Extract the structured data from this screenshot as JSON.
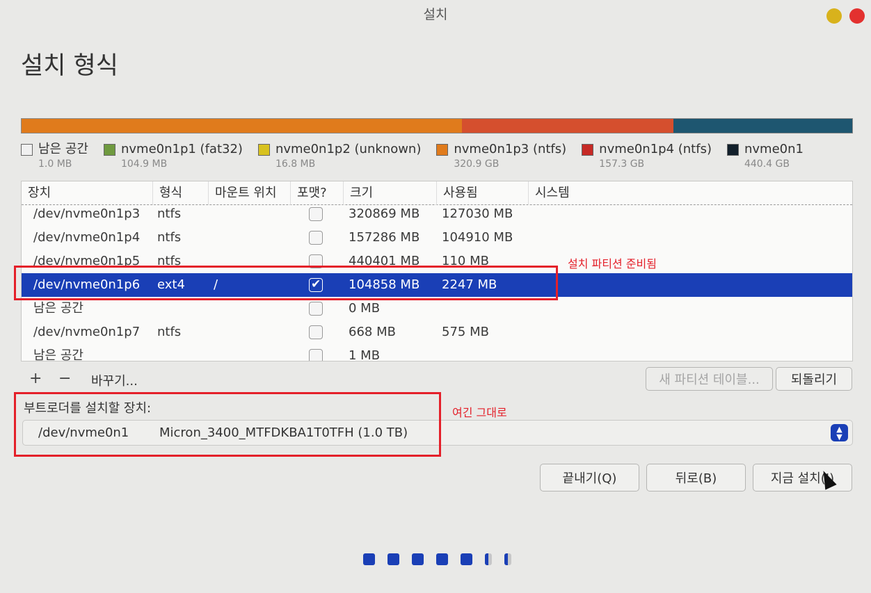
{
  "window": {
    "title": "설치"
  },
  "page": {
    "title": "설치 형식"
  },
  "disk_bar": [
    {
      "name": "nvme0n1p3",
      "color": "#e07b1c",
      "fraction": 0.53
    },
    {
      "name": "nvme0n1p4",
      "color": "#d54f2e",
      "fraction": 0.255
    },
    {
      "name": "nvme0n1p5",
      "color": "#1e5670",
      "fraction": 0.215
    }
  ],
  "legend": [
    {
      "name": "남은 공간",
      "size": "1.0 MB",
      "color": "#f0f0f0"
    },
    {
      "name": "nvme0n1p1 (fat32)",
      "size": "104.9 MB",
      "color": "#6f9a3f"
    },
    {
      "name": "nvme0n1p2 (unknown)",
      "size": "16.8 MB",
      "color": "#d8c21f"
    },
    {
      "name": "nvme0n1p3 (ntfs)",
      "size": "320.9 GB",
      "color": "#e07b1c"
    },
    {
      "name": "nvme0n1p4 (ntfs)",
      "size": "157.3 GB",
      "color": "#c62a25"
    },
    {
      "name": "nvme0n1",
      "size": "440.4 GB",
      "color": "#12202b"
    }
  ],
  "table": {
    "columns": [
      "장치",
      "형식",
      "마운트 위치",
      "포맷?",
      "크기",
      "사용됨",
      "시스템"
    ],
    "rows": [
      {
        "device": "/dev/nvme0n1p3",
        "type": "ntfs",
        "mount": "",
        "format": false,
        "size": "320869 MB",
        "used": "127030 MB",
        "selected": false,
        "checkbox": true
      },
      {
        "device": "/dev/nvme0n1p4",
        "type": "ntfs",
        "mount": "",
        "format": false,
        "size": "157286 MB",
        "used": "104910 MB",
        "selected": false,
        "checkbox": true
      },
      {
        "device": "/dev/nvme0n1p5",
        "type": "ntfs",
        "mount": "",
        "format": false,
        "size": "440401 MB",
        "used": "110 MB",
        "selected": false,
        "checkbox": true
      },
      {
        "device": "/dev/nvme0n1p6",
        "type": "ext4",
        "mount": "/",
        "format": true,
        "size": "104858 MB",
        "used": "2247 MB",
        "selected": true,
        "checkbox": true
      },
      {
        "device": "남은 공간",
        "type": "",
        "mount": "",
        "format": false,
        "size": "0 MB",
        "used": "",
        "selected": false,
        "checkbox": true
      },
      {
        "device": "/dev/nvme0n1p7",
        "type": "ntfs",
        "mount": "",
        "format": false,
        "size": "668 MB",
        "used": "575 MB",
        "selected": false,
        "checkbox": true
      },
      {
        "device": "남은 공간",
        "type": "",
        "mount": "",
        "format": false,
        "size": "1 MB",
        "used": "",
        "selected": false,
        "checkbox": true
      }
    ]
  },
  "toolbar": {
    "add_label": "+",
    "remove_label": "−",
    "change_label": "바꾸기...",
    "new_table_label": "새 파티션 테이블...",
    "revert_label": "되돌리기"
  },
  "bootloader": {
    "label": "부트로더를 설치할 장치:",
    "device": "/dev/nvme0n1",
    "model": "Micron_3400_MTFDKBA1T0TFH (1.0 TB)"
  },
  "buttons": {
    "quit": "끝내기(Q)",
    "back": "뒤로(B)",
    "install": "지금 설치(I)"
  },
  "annotations": {
    "partition_note": "설치 파티션 준비됨",
    "bootloader_note": "여긴 그대로"
  },
  "progress": {
    "steps_completed": 5,
    "steps_total": 7
  }
}
